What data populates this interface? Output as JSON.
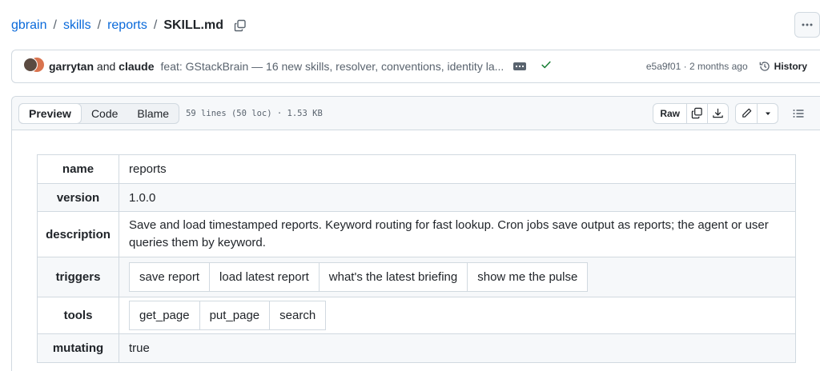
{
  "breadcrumb": {
    "repo": "gbrain",
    "path": [
      "skills",
      "reports"
    ],
    "separator": "/",
    "file": "SKILL.md"
  },
  "header": {
    "more_icon": "kebab-horizontal-icon",
    "copy_icon": "copy-icon"
  },
  "commit": {
    "author1": "garrytan",
    "and": "and",
    "author2": "claude",
    "message": "feat: GStackBrain — 16 new skills, resolver, conventions, identity la...",
    "status_icon": "check-icon",
    "status_color": "#1a7f37",
    "sha": "e5a9f01",
    "dot": "·",
    "age": "2 months ago",
    "history_label": "History"
  },
  "file_header": {
    "tabs": [
      "Preview",
      "Code",
      "Blame"
    ],
    "active_tab": "Preview",
    "info": "59 lines (50 loc) · 1.53 KB",
    "raw_label": "Raw"
  },
  "frontmatter": {
    "name_key": "name",
    "name_val": "reports",
    "version_key": "version",
    "version_val": "1.0.0",
    "description_key": "description",
    "description_val": "Save and load timestamped reports. Keyword routing for fast lookup. Cron jobs save output as reports; the agent or user queries them by keyword.",
    "triggers_key": "triggers",
    "triggers": [
      "save report",
      "load latest report",
      "what's the latest briefing",
      "show me the pulse"
    ],
    "tools_key": "tools",
    "tools": [
      "get_page",
      "put_page",
      "search"
    ],
    "mutating_key": "mutating",
    "mutating_val": "true"
  },
  "colors": {
    "link": "#0969da",
    "border": "#d1d9e0",
    "muted": "#59636e"
  }
}
